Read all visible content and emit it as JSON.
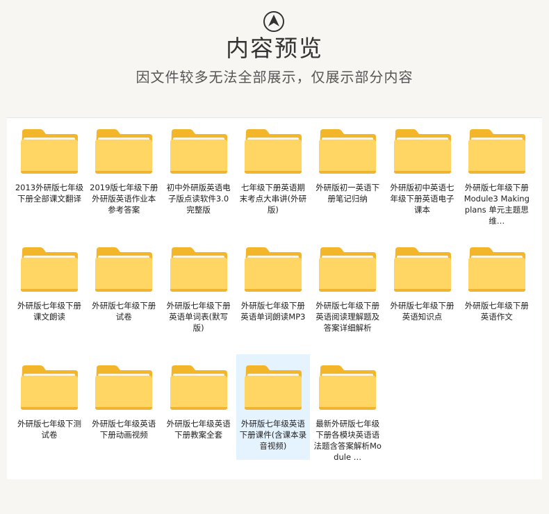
{
  "header": {
    "logo_icon": "up-arrow-circle-icon",
    "title": "内容预览",
    "subtitle": "因文件较多无法全部展示，仅展示部分内容"
  },
  "colors": {
    "background": "#f8f6f2",
    "panel": "#ffffff",
    "selected": "#e5f3ff",
    "folder_back": "#f5b92e",
    "folder_front": "#ffd766"
  },
  "folders": [
    {
      "label": "2013外研版七年级下册全部课文翻译",
      "icon": "folder-icon"
    },
    {
      "label": "2019版七年级下册外研版英语作业本参考答案",
      "icon": "folder-icon"
    },
    {
      "label": "初中外研版英语电子版点读软件3.0 完整版",
      "icon": "folder-icon"
    },
    {
      "label": "七年级下册英语期末考点大串讲(外研版)",
      "icon": "folder-icon"
    },
    {
      "label": "外研版初一英语下册笔记归纳",
      "icon": "folder-icon"
    },
    {
      "label": "外研版初中英语七年级下册英语电子课本",
      "icon": "folder-icon"
    },
    {
      "label": "外研版七年级下册Module3 Making plans 单元主题思维…",
      "icon": "folder-icon"
    },
    {
      "label": "外研版七年级下册课文朗读",
      "icon": "folder-icon"
    },
    {
      "label": "外研版七年级下册试卷",
      "icon": "folder-icon"
    },
    {
      "label": "外研版七年级下册英语单词表(默写版)",
      "icon": "folder-icon"
    },
    {
      "label": "外研版七年级下册英语单词朗读MP3",
      "icon": "folder-icon"
    },
    {
      "label": "外研版七年级下册英语阅读理解题及答案详细解析",
      "icon": "folder-icon"
    },
    {
      "label": "外研版七年级下册英语知识点",
      "icon": "folder-icon"
    },
    {
      "label": "外研版七年级下册英语作文",
      "icon": "folder-icon"
    },
    {
      "label": "外研版七年级下测试卷",
      "icon": "folder-icon"
    },
    {
      "label": "外研版七年级英语下册动画视频",
      "icon": "folder-icon"
    },
    {
      "label": "外研版七年级英语下册教案全套",
      "icon": "folder-icon"
    },
    {
      "label": "外研版七年级英语下册课件(含课本录音视频)",
      "icon": "folder-icon",
      "selected": true
    },
    {
      "label": "最新外研版七年级下册各模块英语语法题含答案解析Module …",
      "icon": "folder-icon"
    }
  ]
}
